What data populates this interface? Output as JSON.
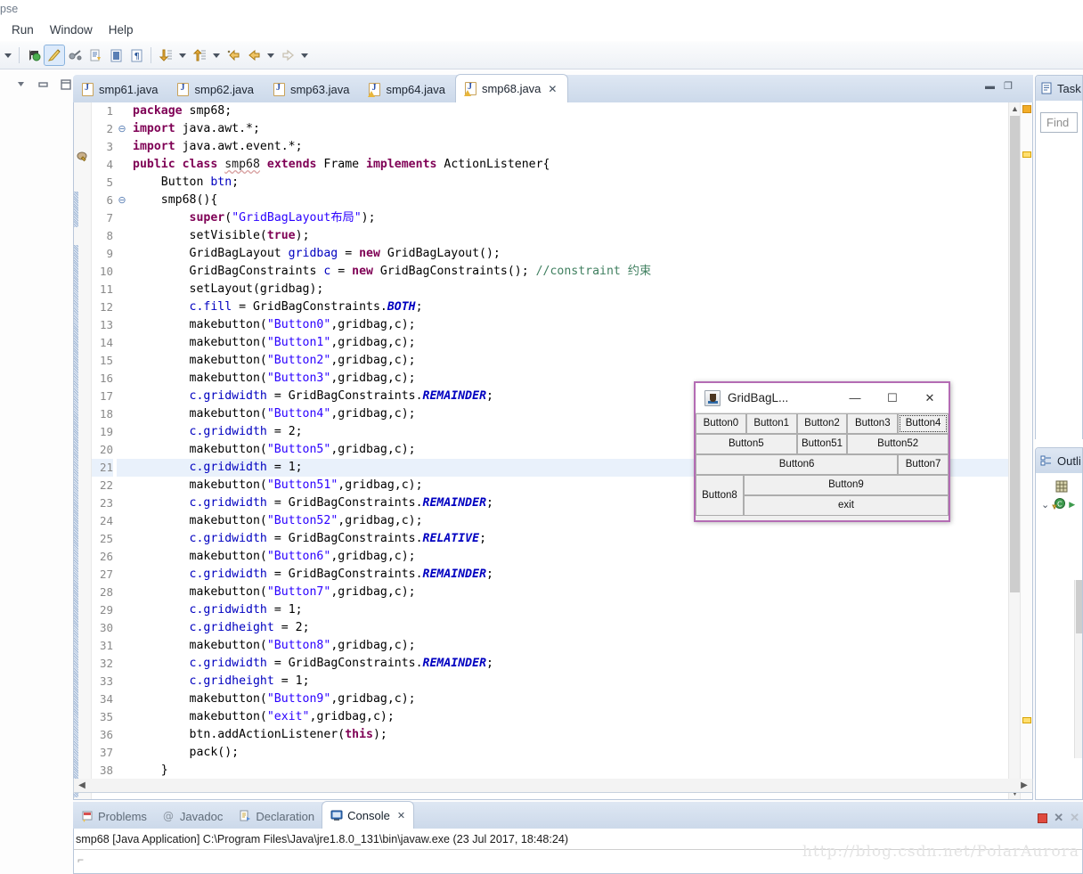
{
  "window": {
    "title_remnant": "pse"
  },
  "menubar": {
    "items": [
      {
        "label": "Run"
      },
      {
        "label": "Window"
      },
      {
        "label": "Help"
      }
    ]
  },
  "toolbar": {
    "icons": [
      {
        "name": "dropdown-caret-icon",
        "glyph": "▾"
      },
      {
        "name": "debug-run-icon",
        "glyph": "🐞"
      },
      {
        "name": "coverage-icon",
        "glyph": "🖌"
      },
      {
        "name": "external-tools-icon",
        "glyph": "🛠"
      },
      {
        "name": "new-java-class-icon",
        "glyph": "📄"
      },
      {
        "name": "toggle-block-selection-icon",
        "glyph": "▤"
      },
      {
        "name": "show-whitespace-icon",
        "glyph": "¶"
      },
      {
        "name": "next-annotation-icon",
        "glyph": "⬇"
      },
      {
        "name": "previous-annotation-icon",
        "glyph": "⬆"
      },
      {
        "name": "last-edit-location-icon",
        "glyph": "↩"
      },
      {
        "name": "back-icon",
        "glyph": "⬅"
      },
      {
        "name": "forward-icon",
        "glyph": "➡"
      }
    ]
  },
  "left_rail": {
    "icons": [
      {
        "name": "minimize-view-icon",
        "glyph": "▽"
      },
      {
        "name": "restore-view-icon",
        "glyph": "▭"
      },
      {
        "name": "maximize-view-icon",
        "glyph": "❐"
      }
    ]
  },
  "editor": {
    "tabs": [
      {
        "label": "smp61.java",
        "active": false,
        "warning": false,
        "closeable": false
      },
      {
        "label": "smp62.java",
        "active": false,
        "warning": false,
        "closeable": false
      },
      {
        "label": "smp63.java",
        "active": false,
        "warning": false,
        "closeable": false
      },
      {
        "label": "smp64.java",
        "active": false,
        "warning": true,
        "closeable": false
      },
      {
        "label": "smp68.java",
        "active": true,
        "warning": true,
        "closeable": true
      }
    ],
    "close_glyph": "✕",
    "minimize_glyph": "▬",
    "maximize_glyph": "❐",
    "current_line": 21,
    "lines": [
      {
        "n": 1,
        "fold": "",
        "tokens": [
          {
            "t": "package ",
            "c": "kw"
          },
          {
            "t": "smp68;",
            "c": "pln"
          }
        ]
      },
      {
        "n": 2,
        "fold": "⊖",
        "tokens": [
          {
            "t": "import ",
            "c": "kw"
          },
          {
            "t": "java.awt.*;",
            "c": "pln"
          }
        ]
      },
      {
        "n": 3,
        "fold": "",
        "tokens": [
          {
            "t": "import ",
            "c": "kw"
          },
          {
            "t": "java.awt.event.*;",
            "c": "pln"
          }
        ]
      },
      {
        "n": 4,
        "fold": "",
        "tokens": [
          {
            "t": "public class ",
            "c": "kw"
          },
          {
            "t": "smp68",
            "c": "und"
          },
          {
            "t": " ",
            "c": "pln"
          },
          {
            "t": "extends ",
            "c": "kw"
          },
          {
            "t": "Frame ",
            "c": "pln"
          },
          {
            "t": "implements ",
            "c": "kw"
          },
          {
            "t": "ActionListener{",
            "c": "pln"
          }
        ]
      },
      {
        "n": 5,
        "fold": "",
        "tokens": [
          {
            "t": "    Button ",
            "c": "pln"
          },
          {
            "t": "btn",
            "c": "fld"
          },
          {
            "t": ";",
            "c": "pln"
          }
        ]
      },
      {
        "n": 6,
        "fold": "⊖",
        "tokens": [
          {
            "t": "    smp68(){",
            "c": "pln"
          }
        ]
      },
      {
        "n": 7,
        "fold": "",
        "tokens": [
          {
            "t": "        ",
            "c": "pln"
          },
          {
            "t": "super",
            "c": "kw"
          },
          {
            "t": "(",
            "c": "pln"
          },
          {
            "t": "\"GridBagLayout布局\"",
            "c": "str"
          },
          {
            "t": ");",
            "c": "pln"
          }
        ]
      },
      {
        "n": 8,
        "fold": "",
        "tokens": [
          {
            "t": "        setVisible(",
            "c": "pln"
          },
          {
            "t": "true",
            "c": "kw"
          },
          {
            "t": ");",
            "c": "pln"
          }
        ]
      },
      {
        "n": 9,
        "fold": "",
        "tokens": [
          {
            "t": "        GridBagLayout ",
            "c": "pln"
          },
          {
            "t": "gridbag",
            "c": "fld"
          },
          {
            "t": " = ",
            "c": "pln"
          },
          {
            "t": "new ",
            "c": "kw"
          },
          {
            "t": "GridBagLayout();",
            "c": "pln"
          }
        ]
      },
      {
        "n": 10,
        "fold": "",
        "tokens": [
          {
            "t": "        GridBagConstraints ",
            "c": "pln"
          },
          {
            "t": "c",
            "c": "fld"
          },
          {
            "t": " = ",
            "c": "pln"
          },
          {
            "t": "new ",
            "c": "kw"
          },
          {
            "t": "GridBagConstraints(); ",
            "c": "pln"
          },
          {
            "t": "//constraint 约束",
            "c": "cmt"
          }
        ]
      },
      {
        "n": 11,
        "fold": "",
        "tokens": [
          {
            "t": "        setLayout(gridbag);",
            "c": "pln"
          }
        ]
      },
      {
        "n": 12,
        "fold": "",
        "tokens": [
          {
            "t": "        ",
            "c": "pln"
          },
          {
            "t": "c.fill",
            "c": "fld"
          },
          {
            "t": " = GridBagConstraints.",
            "c": "pln"
          },
          {
            "t": "BOTH",
            "c": "sf"
          },
          {
            "t": ";",
            "c": "pln"
          }
        ]
      },
      {
        "n": 13,
        "fold": "",
        "tokens": [
          {
            "t": "        makebutton(",
            "c": "pln"
          },
          {
            "t": "\"Button0\"",
            "c": "str"
          },
          {
            "t": ",gridbag,c);",
            "c": "pln"
          }
        ]
      },
      {
        "n": 14,
        "fold": "",
        "tokens": [
          {
            "t": "        makebutton(",
            "c": "pln"
          },
          {
            "t": "\"Button1\"",
            "c": "str"
          },
          {
            "t": ",gridbag,c);",
            "c": "pln"
          }
        ]
      },
      {
        "n": 15,
        "fold": "",
        "tokens": [
          {
            "t": "        makebutton(",
            "c": "pln"
          },
          {
            "t": "\"Button2\"",
            "c": "str"
          },
          {
            "t": ",gridbag,c);",
            "c": "pln"
          }
        ]
      },
      {
        "n": 16,
        "fold": "",
        "tokens": [
          {
            "t": "        makebutton(",
            "c": "pln"
          },
          {
            "t": "\"Button3\"",
            "c": "str"
          },
          {
            "t": ",gridbag,c);",
            "c": "pln"
          }
        ]
      },
      {
        "n": 17,
        "fold": "",
        "tokens": [
          {
            "t": "        ",
            "c": "pln"
          },
          {
            "t": "c.gridwidth",
            "c": "fld"
          },
          {
            "t": " = GridBagConstraints.",
            "c": "pln"
          },
          {
            "t": "REMAINDER",
            "c": "sf"
          },
          {
            "t": ";",
            "c": "pln"
          }
        ]
      },
      {
        "n": 18,
        "fold": "",
        "tokens": [
          {
            "t": "        makebutton(",
            "c": "pln"
          },
          {
            "t": "\"Button4\"",
            "c": "str"
          },
          {
            "t": ",gridbag,c);",
            "c": "pln"
          }
        ]
      },
      {
        "n": 19,
        "fold": "",
        "tokens": [
          {
            "t": "        ",
            "c": "pln"
          },
          {
            "t": "c.gridwidth",
            "c": "fld"
          },
          {
            "t": " = 2;",
            "c": "pln"
          }
        ]
      },
      {
        "n": 20,
        "fold": "",
        "tokens": [
          {
            "t": "        makebutton(",
            "c": "pln"
          },
          {
            "t": "\"Button5\"",
            "c": "str"
          },
          {
            "t": ",gridbag,c);",
            "c": "pln"
          }
        ]
      },
      {
        "n": 21,
        "fold": "",
        "tokens": [
          {
            "t": "        ",
            "c": "pln"
          },
          {
            "t": "c.gridwidth",
            "c": "fld"
          },
          {
            "t": " = 1;",
            "c": "pln"
          }
        ]
      },
      {
        "n": 22,
        "fold": "",
        "tokens": [
          {
            "t": "        makebutton(",
            "c": "pln"
          },
          {
            "t": "\"Button51\"",
            "c": "str"
          },
          {
            "t": ",gridbag,c);",
            "c": "pln"
          }
        ]
      },
      {
        "n": 23,
        "fold": "",
        "tokens": [
          {
            "t": "        ",
            "c": "pln"
          },
          {
            "t": "c.gridwidth",
            "c": "fld"
          },
          {
            "t": " = GridBagConstraints.",
            "c": "pln"
          },
          {
            "t": "REMAINDER",
            "c": "sf"
          },
          {
            "t": ";",
            "c": "pln"
          }
        ]
      },
      {
        "n": 24,
        "fold": "",
        "tokens": [
          {
            "t": "        makebutton(",
            "c": "pln"
          },
          {
            "t": "\"Button52\"",
            "c": "str"
          },
          {
            "t": ",gridbag,c);",
            "c": "pln"
          }
        ]
      },
      {
        "n": 25,
        "fold": "",
        "tokens": [
          {
            "t": "        ",
            "c": "pln"
          },
          {
            "t": "c.gridwidth",
            "c": "fld"
          },
          {
            "t": " = GridBagConstraints.",
            "c": "pln"
          },
          {
            "t": "RELATIVE",
            "c": "sf"
          },
          {
            "t": ";",
            "c": "pln"
          }
        ]
      },
      {
        "n": 26,
        "fold": "",
        "tokens": [
          {
            "t": "        makebutton(",
            "c": "pln"
          },
          {
            "t": "\"Button6\"",
            "c": "str"
          },
          {
            "t": ",gridbag,c);",
            "c": "pln"
          }
        ]
      },
      {
        "n": 27,
        "fold": "",
        "tokens": [
          {
            "t": "        ",
            "c": "pln"
          },
          {
            "t": "c.gridwidth",
            "c": "fld"
          },
          {
            "t": " = GridBagConstraints.",
            "c": "pln"
          },
          {
            "t": "REMAINDER",
            "c": "sf"
          },
          {
            "t": ";",
            "c": "pln"
          }
        ]
      },
      {
        "n": 28,
        "fold": "",
        "tokens": [
          {
            "t": "        makebutton(",
            "c": "pln"
          },
          {
            "t": "\"Button7\"",
            "c": "str"
          },
          {
            "t": ",gridbag,c);",
            "c": "pln"
          }
        ]
      },
      {
        "n": 29,
        "fold": "",
        "tokens": [
          {
            "t": "        ",
            "c": "pln"
          },
          {
            "t": "c.gridwidth",
            "c": "fld"
          },
          {
            "t": " = 1;",
            "c": "pln"
          }
        ]
      },
      {
        "n": 30,
        "fold": "",
        "tokens": [
          {
            "t": "        ",
            "c": "pln"
          },
          {
            "t": "c.gridheight",
            "c": "fld"
          },
          {
            "t": " = 2;",
            "c": "pln"
          }
        ]
      },
      {
        "n": 31,
        "fold": "",
        "tokens": [
          {
            "t": "        makebutton(",
            "c": "pln"
          },
          {
            "t": "\"Button8\"",
            "c": "str"
          },
          {
            "t": ",gridbag,c);",
            "c": "pln"
          }
        ]
      },
      {
        "n": 32,
        "fold": "",
        "tokens": [
          {
            "t": "        ",
            "c": "pln"
          },
          {
            "t": "c.gridwidth",
            "c": "fld"
          },
          {
            "t": " = GridBagConstraints.",
            "c": "pln"
          },
          {
            "t": "REMAINDER",
            "c": "sf"
          },
          {
            "t": ";",
            "c": "pln"
          }
        ]
      },
      {
        "n": 33,
        "fold": "",
        "tokens": [
          {
            "t": "        ",
            "c": "pln"
          },
          {
            "t": "c.gridheight",
            "c": "fld"
          },
          {
            "t": " = 1;",
            "c": "pln"
          }
        ]
      },
      {
        "n": 34,
        "fold": "",
        "tokens": [
          {
            "t": "        makebutton(",
            "c": "pln"
          },
          {
            "t": "\"Button9\"",
            "c": "str"
          },
          {
            "t": ",gridbag,c);",
            "c": "pln"
          }
        ]
      },
      {
        "n": 35,
        "fold": "",
        "tokens": [
          {
            "t": "        makebutton(",
            "c": "pln"
          },
          {
            "t": "\"exit\"",
            "c": "str"
          },
          {
            "t": ",gridbag,c);",
            "c": "pln"
          }
        ]
      },
      {
        "n": 36,
        "fold": "",
        "tokens": [
          {
            "t": "        btn.addActionListener(",
            "c": "pln"
          },
          {
            "t": "this",
            "c": "kw"
          },
          {
            "t": ");",
            "c": "pln"
          }
        ]
      },
      {
        "n": 37,
        "fold": "",
        "tokens": [
          {
            "t": "        pack();",
            "c": "pln"
          }
        ]
      },
      {
        "n": 38,
        "fold": "",
        "tokens": [
          {
            "t": "    }",
            "c": "pln"
          }
        ]
      }
    ]
  },
  "awt_window": {
    "title": "GridBagL...",
    "app_icon": "java-coffee-cup-icon",
    "minimize_glyph": "—",
    "maximize_glyph": "☐",
    "close_glyph": "✕",
    "border_color": "#b46cb4",
    "rows": [
      {
        "buttons": [
          {
            "label": "Button0",
            "flex": 1,
            "focused": false
          },
          {
            "label": "Button1",
            "flex": 1,
            "focused": false
          },
          {
            "label": "Button2",
            "flex": 1,
            "focused": false
          },
          {
            "label": "Button3",
            "flex": 1,
            "focused": false
          },
          {
            "label": "Button4",
            "flex": 1,
            "focused": true
          }
        ]
      },
      {
        "buttons": [
          {
            "label": "Button5",
            "flex": 2,
            "focused": false
          },
          {
            "label": "Button51",
            "flex": 1,
            "focused": false
          },
          {
            "label": "Button52",
            "flex": 2,
            "focused": false
          }
        ]
      },
      {
        "buttons": [
          {
            "label": "Button6",
            "flex": 4,
            "focused": false
          },
          {
            "label": "Button7",
            "flex": 1,
            "focused": false
          }
        ]
      }
    ],
    "bottom_left": {
      "label": "Button8"
    },
    "bottom_right": [
      {
        "label": "Button9"
      },
      {
        "label": "exit"
      }
    ]
  },
  "task_view": {
    "title": "Task",
    "icon": "task-list-icon",
    "find_placeholder": "Find"
  },
  "outline_view": {
    "title": "Outli",
    "icon": "outline-icon",
    "entries": [
      {
        "icon": "package-icon",
        "expander": ""
      },
      {
        "icon": "class-icon",
        "expander": "⌄"
      }
    ]
  },
  "console": {
    "tabs": [
      {
        "label": "Problems",
        "icon": "problems-icon",
        "active": false
      },
      {
        "label": "Javadoc",
        "icon": "javadoc-icon",
        "active": false
      },
      {
        "label": "Declaration",
        "icon": "declaration-icon",
        "active": false
      },
      {
        "label": "Console",
        "icon": "console-icon",
        "active": true
      }
    ],
    "close_glyph": "✕",
    "launch_line": "smp68 [Java Application] C:\\Program Files\\Java\\jre1.8.0_131\\bin\\javaw.exe (23 Jul 2017, 18:48:24)",
    "tools": [
      {
        "name": "terminate-button",
        "glyph": ""
      },
      {
        "name": "remove-launch-button",
        "glyph": "✕"
      },
      {
        "name": "remove-all-terminated-button",
        "glyph": "✕"
      }
    ]
  },
  "watermark": {
    "text": "http://blog.csdn.net/PolarAurora"
  }
}
